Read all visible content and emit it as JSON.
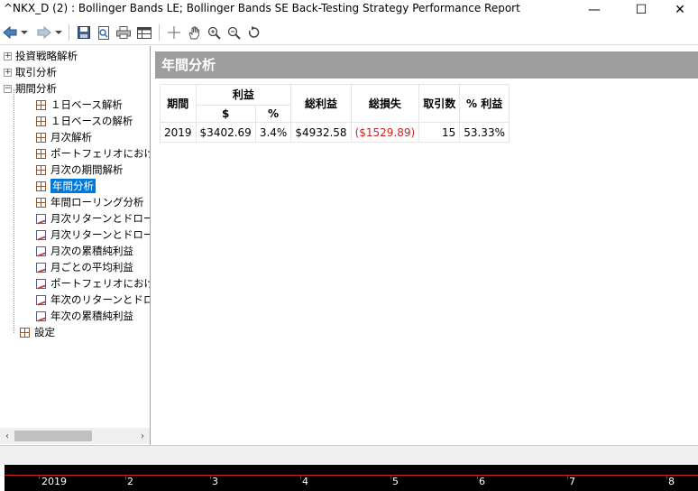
{
  "window": {
    "title": "^NKX_D (2) : Bollinger Bands LE; Bollinger Bands SE Back-Testing Strategy Performance Report",
    "minimize": "—",
    "maximize": "☐",
    "close": "✕"
  },
  "toolbar": {
    "icons": [
      "back-arrow-icon",
      "dropdown-icon",
      "forward-arrow-icon",
      "dropdown-icon",
      "save-icon",
      "print-preview-icon",
      "print-icon",
      "table-icon",
      "crosshair-icon",
      "pan-hand-icon",
      "zoom-in-icon",
      "zoom-out-icon",
      "reset-zoom-icon"
    ]
  },
  "tree": {
    "top": [
      {
        "label": "投資戦略解析",
        "expander": "+"
      },
      {
        "label": "取引分析",
        "expander": "+"
      },
      {
        "label": "期間分析",
        "expander": "−"
      }
    ],
    "children": [
      {
        "label": "１日ベース解析",
        "icon": "grid"
      },
      {
        "label": "１日ベースの解析",
        "icon": "grid"
      },
      {
        "label": "月次解析",
        "icon": "grid"
      },
      {
        "label": "ポートフェリオにおける期",
        "icon": "grid"
      },
      {
        "label": "月次の期間解析",
        "icon": "grid"
      },
      {
        "label": "年間分析",
        "icon": "grid"
      },
      {
        "label": "年間ローリング分析",
        "icon": "grid"
      },
      {
        "label": "月次リターンとドローダウ",
        "icon": "chart"
      },
      {
        "label": "月次リターンとドローダウ",
        "icon": "chart"
      },
      {
        "label": "月次の累積純利益",
        "icon": "chart"
      },
      {
        "label": "月ごとの平均利益",
        "icon": "chart"
      },
      {
        "label": "ポートフェリオにおけるリ",
        "icon": "chart"
      },
      {
        "label": "年次のリターンとドローダ",
        "icon": "chart"
      },
      {
        "label": "年次の累積純利益",
        "icon": "chart"
      }
    ],
    "settings": "設定",
    "selected": "年間分析"
  },
  "scroll": {
    "left": "‹",
    "right": "›"
  },
  "report": {
    "heading": "年間分析",
    "headers": {
      "period": "期間",
      "profit": "利益",
      "profit_dollar": "$",
      "profit_pct": "%",
      "gross_profit": "総利益",
      "gross_loss": "総損失",
      "trades": "取引数",
      "pct_profitable": "% 利益"
    },
    "rows": [
      {
        "period": "2019",
        "profit_dollar": "$3402.69",
        "profit_pct": "3.4%",
        "gross_profit": "$4932.58",
        "gross_loss": "($1529.89)",
        "trades": "15",
        "pct_profitable": "53.33%"
      }
    ]
  },
  "timeline": {
    "labels": [
      "2019",
      "2",
      "3",
      "4",
      "5",
      "6",
      "7",
      "8"
    ],
    "background": "#000000",
    "line_color": "#d02020"
  }
}
